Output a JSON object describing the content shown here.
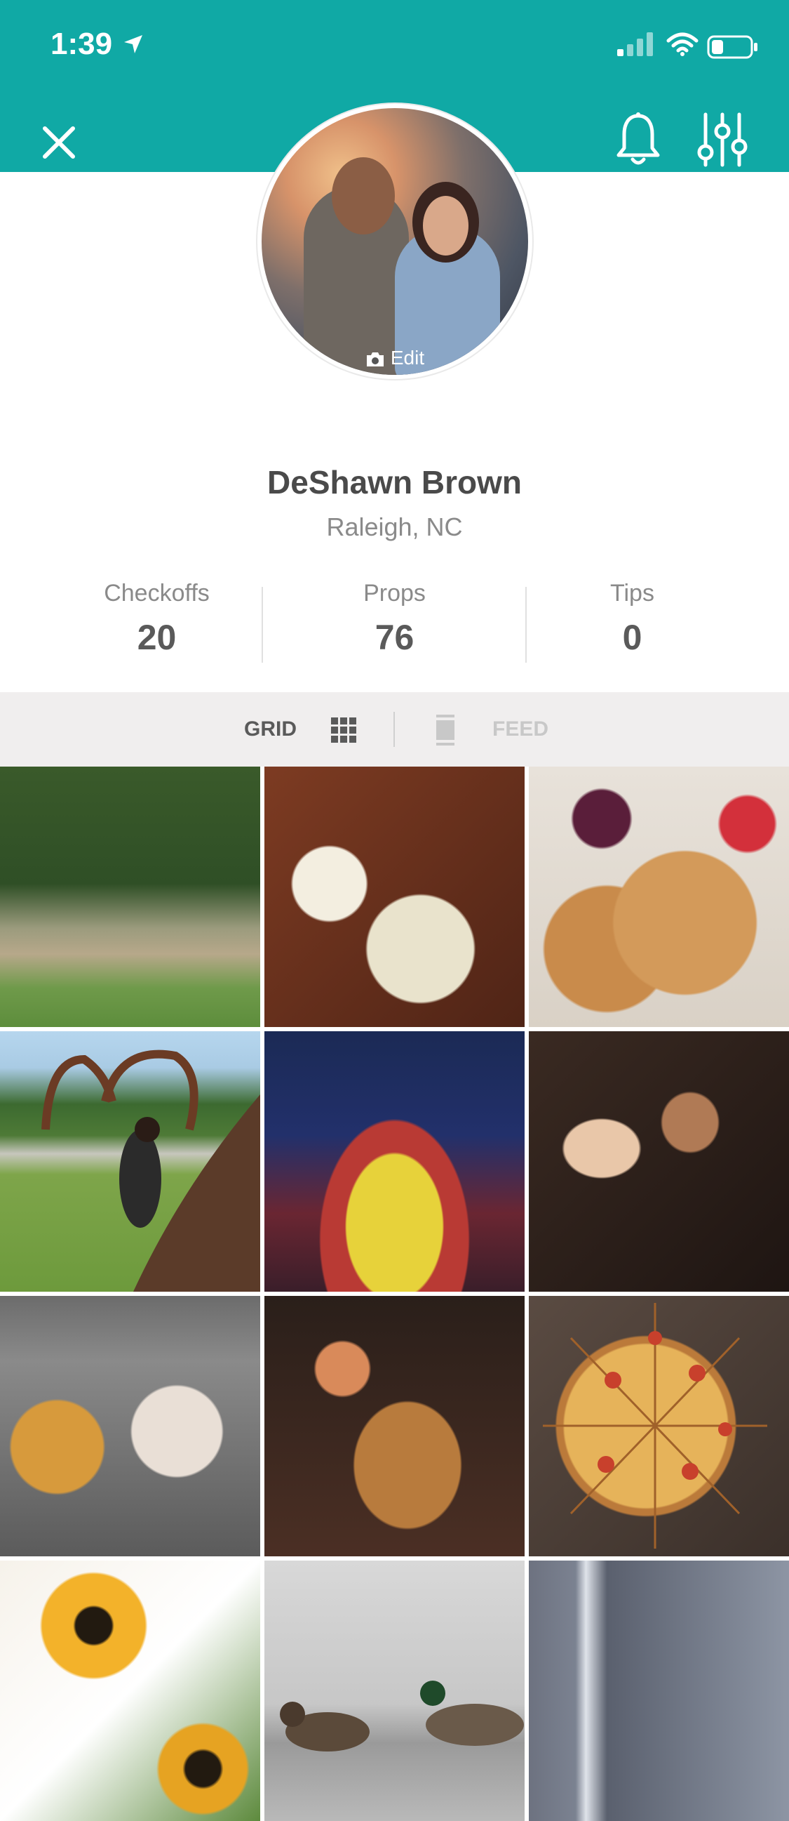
{
  "status_bar": {
    "time": "1:39"
  },
  "header": {
    "bg_color": "#10a9a5"
  },
  "profile": {
    "edit_label": "Edit",
    "name": "DeShawn Brown",
    "location": "Raleigh, NC"
  },
  "stats": [
    {
      "label": "Checkoffs",
      "value": "20"
    },
    {
      "label": "Props",
      "value": "76"
    },
    {
      "label": "Tips",
      "value": "0"
    }
  ],
  "view_toggle": {
    "grid_label": "GRID",
    "feed_label": "FEED",
    "active": "grid"
  },
  "photos": [
    {
      "name": "park-amphitheater"
    },
    {
      "name": "dinner-plates"
    },
    {
      "name": "pancakes"
    },
    {
      "name": "arch-sculpture"
    },
    {
      "name": "basketball-arena"
    },
    {
      "name": "couple-selfie"
    },
    {
      "name": "coffee-donuts"
    },
    {
      "name": "nachos-drinks"
    },
    {
      "name": "pizza"
    },
    {
      "name": "sunflowers"
    },
    {
      "name": "ducks"
    },
    {
      "name": "city-skyline"
    }
  ]
}
